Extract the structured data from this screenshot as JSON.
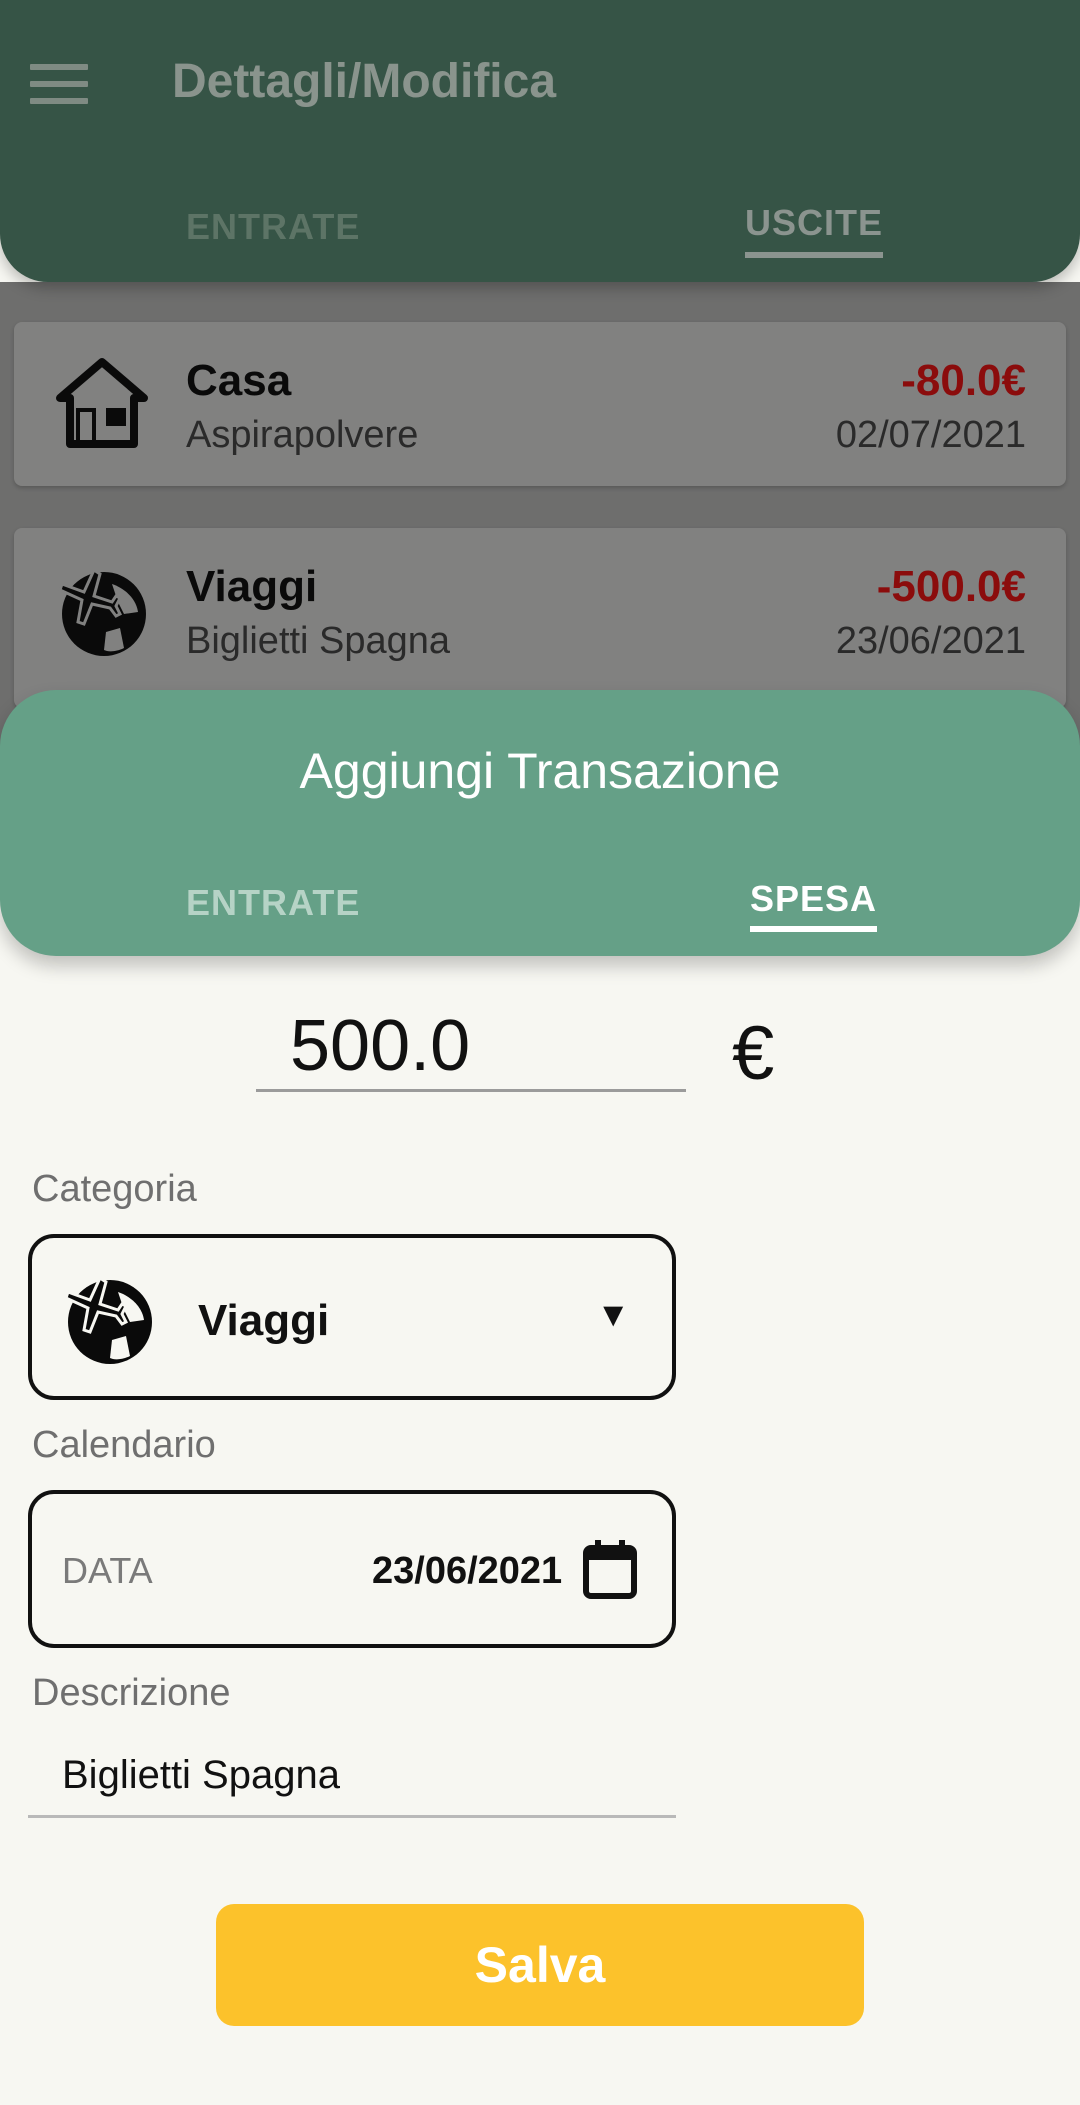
{
  "app_bar": {
    "title": "Dettagli/Modifica",
    "menu_icon": "hamburger-menu-icon",
    "tabs": [
      {
        "label": "ENTRATE",
        "selected": false
      },
      {
        "label": "USCITE",
        "selected": true
      }
    ]
  },
  "transactions": [
    {
      "icon": "house-icon",
      "category": "Casa",
      "description": "Aspirapolvere",
      "amount": "-80.0€",
      "date": "02/07/2021"
    },
    {
      "icon": "travel-globe-icon",
      "category": "Viaggi",
      "description": "Biglietti Spagna",
      "amount": "-500.0€",
      "date": "23/06/2021"
    }
  ],
  "sheet": {
    "title": "Aggiungi Transazione",
    "tabs": [
      {
        "label": "ENTRATE",
        "selected": false
      },
      {
        "label": "SPESA",
        "selected": true
      }
    ],
    "amount_value": "500.0",
    "currency": "€",
    "category_label": "Categoria",
    "category_value": "Viaggi",
    "category_icon": "travel-globe-icon",
    "dropdown_arrow": "▼",
    "calendar_label": "Calendario",
    "date_placeholder": "DATA",
    "date_value": "23/06/2021",
    "calendar_icon": "calendar-icon",
    "description_label": "Descrizione",
    "description_value": "Biglietti Spagna",
    "save_label": "Salva"
  },
  "colors": {
    "app_bar": "#365446",
    "sheet_header": "#65a087",
    "save_button": "#fcc22b",
    "negative_amount": "#8b0c0c"
  }
}
